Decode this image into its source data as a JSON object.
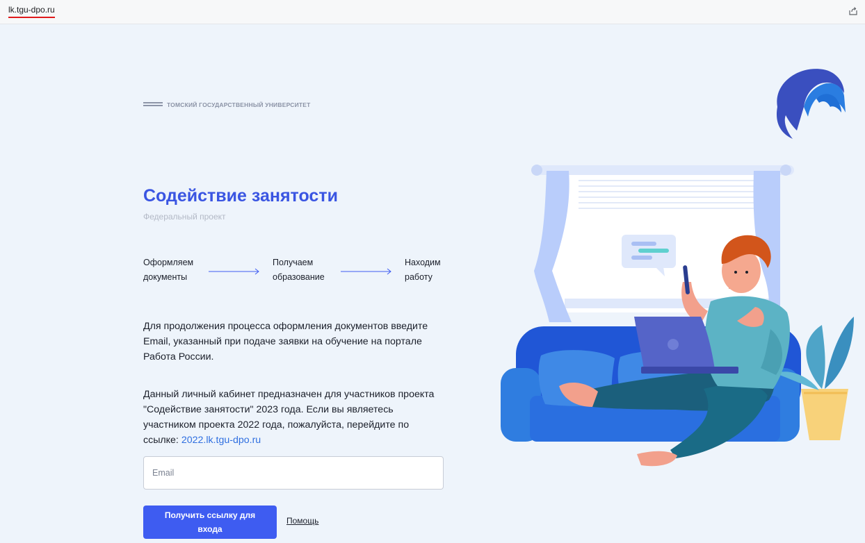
{
  "browser": {
    "url": "lk.tgu-dpo.ru",
    "share_icon": "share-icon"
  },
  "university": {
    "name": "ТОМСКИЙ ГОСУДАРСТВЕННЫЙ УНИВЕРСИТЕТ"
  },
  "hero": {
    "title": "Содействие занятости",
    "subtitle": "Федеральный проект"
  },
  "steps": [
    {
      "line1": "Оформляем",
      "line2": "документы"
    },
    {
      "line1": "Получаем",
      "line2": "образование"
    },
    {
      "line1": "Находим",
      "line2": "работу"
    }
  ],
  "info": {
    "paragraph1": "Для продолжения процесса оформления документов введите Email, указанный при подаче заявки на обучение на портале Работа России.",
    "paragraph2_text": "Данный личный кабинет предназначен для участников проекта \"Содействие занятости\" 2023 года. Если вы являетесь участником проекта 2022 года, пожалуйста, перейдите по ссылке: ",
    "paragraph2_link": "2022.lk.tgu-dpo.ru"
  },
  "form": {
    "email_placeholder": "Email",
    "email_value": "",
    "submit_label": "Получить ссылку для входа",
    "help_label": "Помощь"
  },
  "colors": {
    "accent": "#3e5cf1",
    "title": "#3a55e2",
    "link": "#2f6fe0",
    "background": "#eef4fb"
  }
}
